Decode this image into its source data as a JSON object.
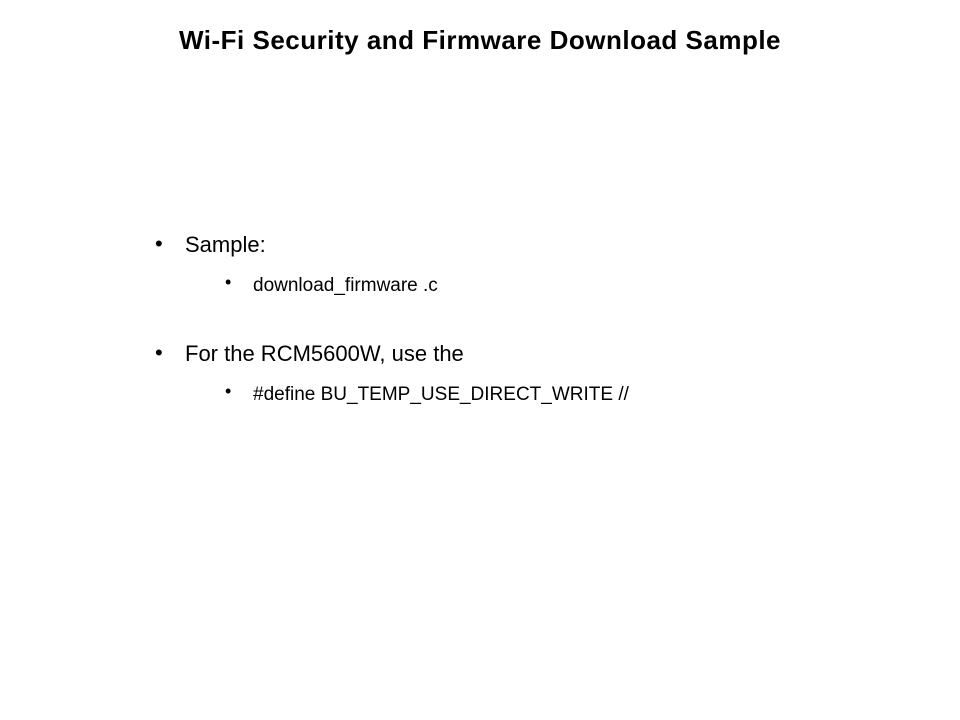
{
  "slide": {
    "title": "Wi-Fi Security and Firmware Download Sample",
    "bullets": [
      {
        "text": "Sample:",
        "sub": [
          {
            "text": "download_firmware .c"
          }
        ]
      },
      {
        "text": "For the RCM5600W, use the",
        "sub": [
          {
            "text": "#define BU_TEMP_USE_DIRECT_WRITE //"
          }
        ]
      }
    ]
  }
}
